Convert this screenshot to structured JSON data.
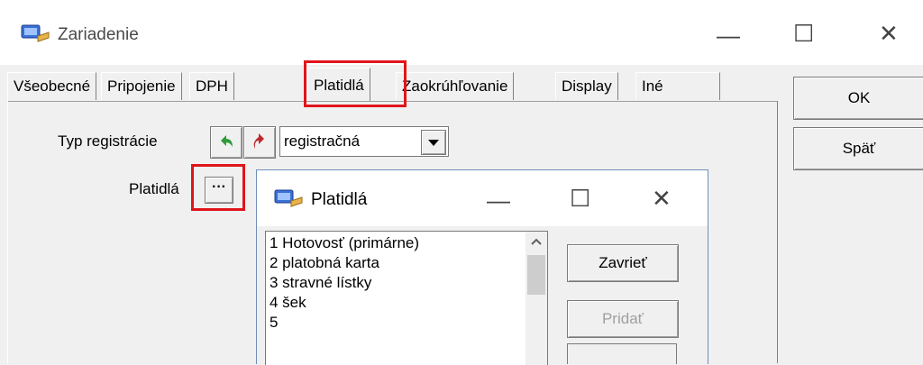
{
  "window": {
    "title": "Zariadenie",
    "icon": "computer-icon",
    "controls": {
      "minimize": "—",
      "maximize": "☐",
      "close": "✕"
    }
  },
  "tabs": [
    {
      "label": "Všeobecné"
    },
    {
      "label": "Pripojenie"
    },
    {
      "label": "DPH"
    },
    {
      "label": "Platidlá",
      "active": true
    },
    {
      "label": "Zaokrúhľovanie"
    },
    {
      "label": "Display"
    },
    {
      "label": "Iné"
    }
  ],
  "side_buttons": {
    "ok": "OK",
    "back": "Späť"
  },
  "form": {
    "typ_label": "Typ registrácie",
    "typ_value": "registračná",
    "platidla_label": "Platidlá",
    "ellipsis": "···"
  },
  "dialog": {
    "title": "Platidlá",
    "icon": "computer-icon",
    "controls": {
      "minimize": "—",
      "maximize": "☐",
      "close": "✕"
    },
    "items": [
      "1 Hotovosť (primárne)",
      "2 platobná karta",
      "3 stravné lístky",
      "4 šek",
      "5"
    ],
    "close_button": "Zavrieť",
    "add_button": "Pridať"
  },
  "colors": {
    "highlight": "#e0151b",
    "window_border": "#6e8fb8"
  }
}
